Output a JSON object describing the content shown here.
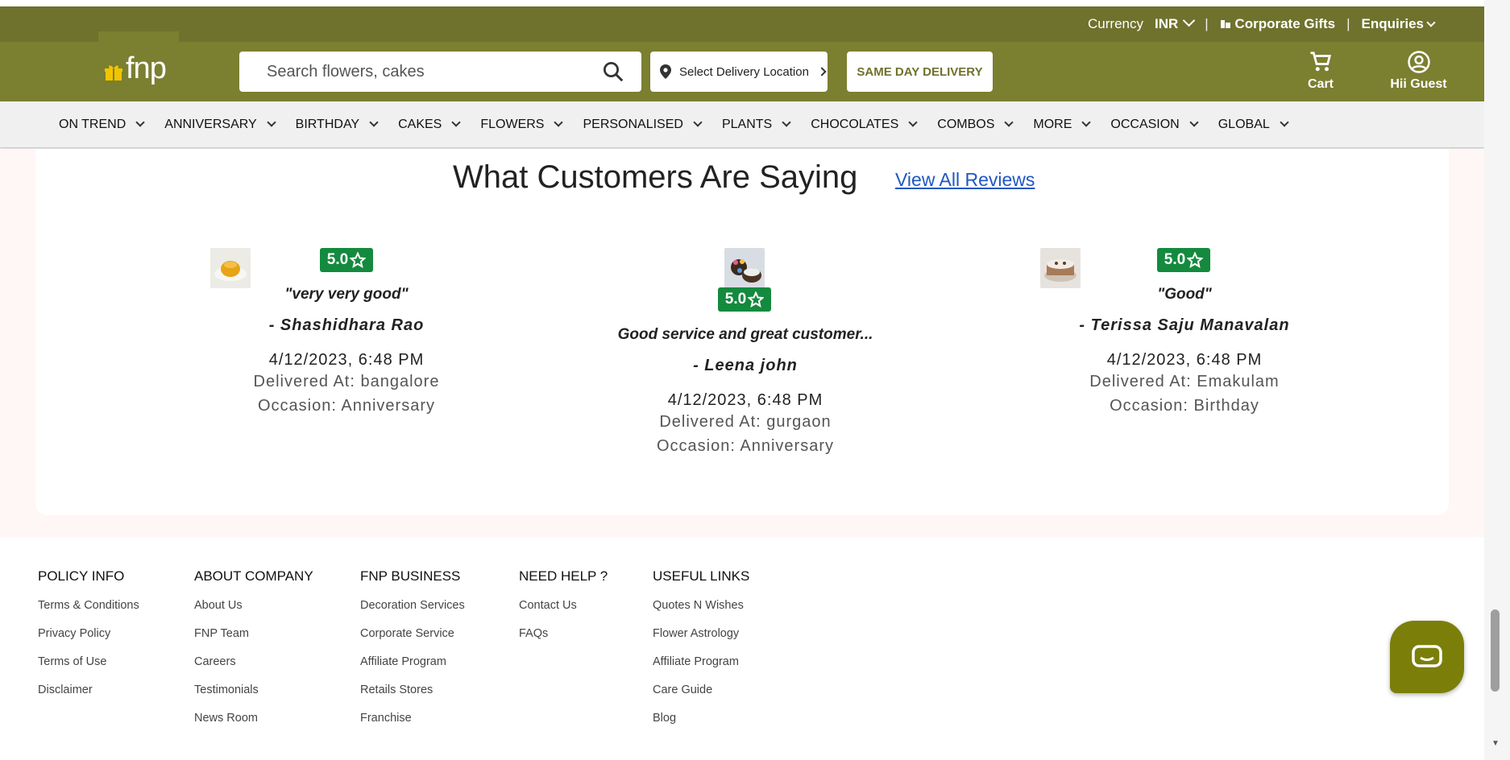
{
  "topbar": {
    "currency_label": "Currency",
    "currency_value": "INR",
    "sep1": "|",
    "corporate_gifts": "Corporate Gifts",
    "sep2": "|",
    "enquiries": "Enquiries"
  },
  "header": {
    "logo_text": "fnp",
    "search_placeholder": "Search flowers, cakes",
    "location_label": "Select Delivery Location",
    "same_day_label": "SAME DAY DELIVERY",
    "cart_label": "Cart",
    "user_label": "Hii Guest"
  },
  "nav": {
    "items": [
      "ON TREND",
      "ANNIVERSARY",
      "BIRTHDAY",
      "CAKES",
      "FLOWERS",
      "PERSONALISED",
      "PLANTS",
      "CHOCOLATES",
      "COMBOS",
      "MORE",
      "OCCASION",
      "GLOBAL"
    ]
  },
  "reviews": {
    "title": "What Customers Are Saying",
    "view_all": "View All Reviews",
    "items": [
      {
        "rating": "5.0",
        "quote": "\"very very good\"",
        "author": "- Shashidhara Rao",
        "date": "4/12/2023, 6:48 PM",
        "delivered": "Delivered At: bangalore",
        "occasion": "Occasion: Anniversary"
      },
      {
        "rating": "5.0",
        "quote": "Good service and great customer...",
        "author": "- Leena john",
        "date": "4/12/2023, 6:48 PM",
        "delivered": "Delivered At: gurgaon",
        "occasion": "Occasion: Anniversary"
      },
      {
        "rating": "5.0",
        "quote": "\"Good\"",
        "author": "- Terissa Saju Manavalan",
        "date": "4/12/2023, 6:48 PM",
        "delivered": "Delivered At: Emakulam",
        "occasion": "Occasion: Birthday"
      }
    ]
  },
  "footer": {
    "columns": [
      {
        "heading": "POLICY INFO",
        "links": [
          "Terms & Conditions",
          "Privacy Policy",
          "Terms of Use",
          "Disclaimer"
        ]
      },
      {
        "heading": "ABOUT COMPANY",
        "links": [
          "About Us",
          "FNP Team",
          "Careers",
          "Testimonials",
          "News Room"
        ]
      },
      {
        "heading": "FNP BUSINESS",
        "links": [
          "Decoration Services",
          "Corporate Service",
          "Affiliate Program",
          "Retails Stores",
          "Franchise"
        ]
      },
      {
        "heading": "NEED HELP ?",
        "links": [
          "Contact Us",
          "FAQs"
        ]
      },
      {
        "heading": "USEFUL LINKS",
        "links": [
          "Quotes N Wishes",
          "Flower Astrology",
          "Affiliate Program",
          "Care Guide",
          "Blog"
        ]
      }
    ]
  },
  "colors": {
    "brand": "#7b7f30",
    "rating_green": "#148a3e",
    "link_blue": "#1f57c4"
  }
}
